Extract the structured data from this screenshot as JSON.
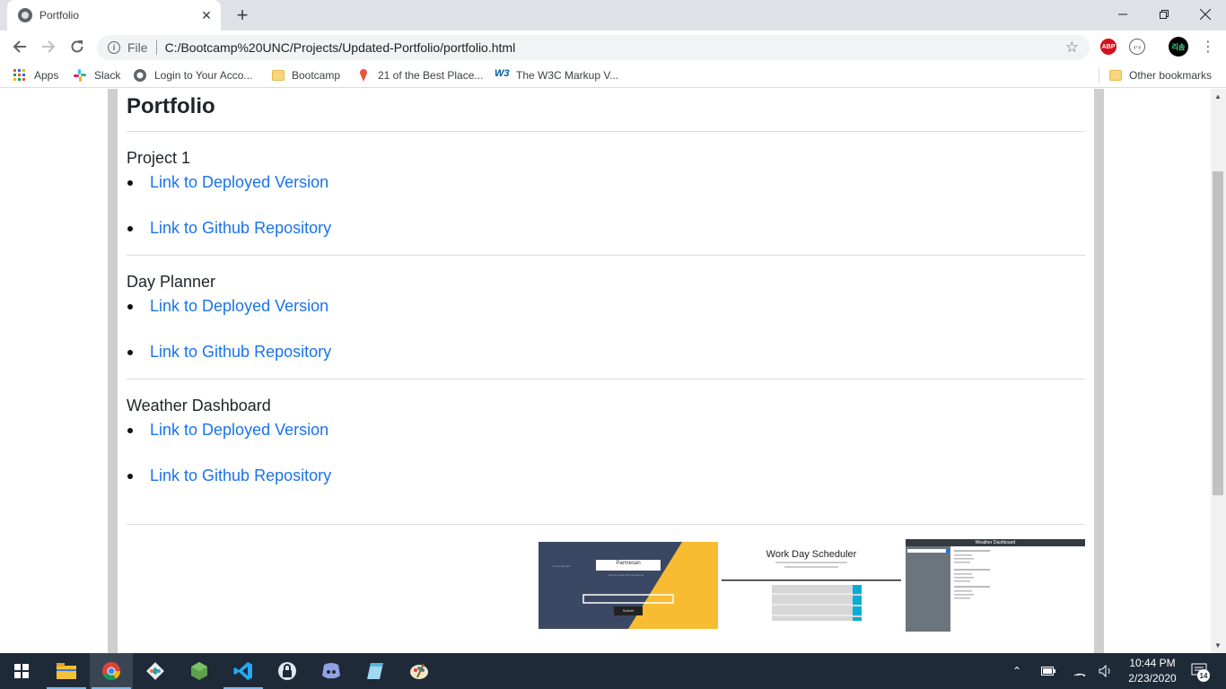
{
  "browser": {
    "tab_title": "Portfolio",
    "scheme_label": "File",
    "url": "C:/Bootcamp%20UNC/Projects/Updated-Portfolio/portfolio.html",
    "ext_abp": "ABP",
    "profile_initials": "리솜"
  },
  "bookmarks": {
    "items": [
      {
        "label": "Apps",
        "icon": "apps-grid-icon"
      },
      {
        "label": "Slack",
        "icon": "slack-icon"
      },
      {
        "label": "Login to Your Acco...",
        "icon": "globe-icon"
      },
      {
        "label": "Bootcamp",
        "icon": "folder-icon"
      },
      {
        "label": "21 of the Best Place...",
        "icon": "pin-icon"
      },
      {
        "label": "The W3C Markup V...",
        "icon": "w3c-icon"
      }
    ],
    "other": "Other bookmarks"
  },
  "page": {
    "title": "Portfolio",
    "projects": [
      {
        "name": "Project 1",
        "deployed": "Link to Deployed Version",
        "github": "Link to Github Repository"
      },
      {
        "name": "Day Planner",
        "deployed": "Link to Deployed Version",
        "github": "Link to Github Repository"
      },
      {
        "name": "Weather Dashboard",
        "deployed": "Link to Deployed Version",
        "github": "Link to Github Repository"
      }
    ],
    "thumbs": {
      "project1_title": "Parmesan",
      "project1_button": "Submit",
      "scheduler_title": "Work Day Scheduler",
      "weather_title": "Weather Dashboard"
    }
  },
  "taskbar": {
    "time": "10:44 PM",
    "date": "2/23/2020",
    "notifications": "14"
  },
  "colors": {
    "link": "#1a73e8",
    "taskbar": "#1f2a38",
    "accent_yellow": "#f7bc31",
    "navy": "#3b4863"
  }
}
